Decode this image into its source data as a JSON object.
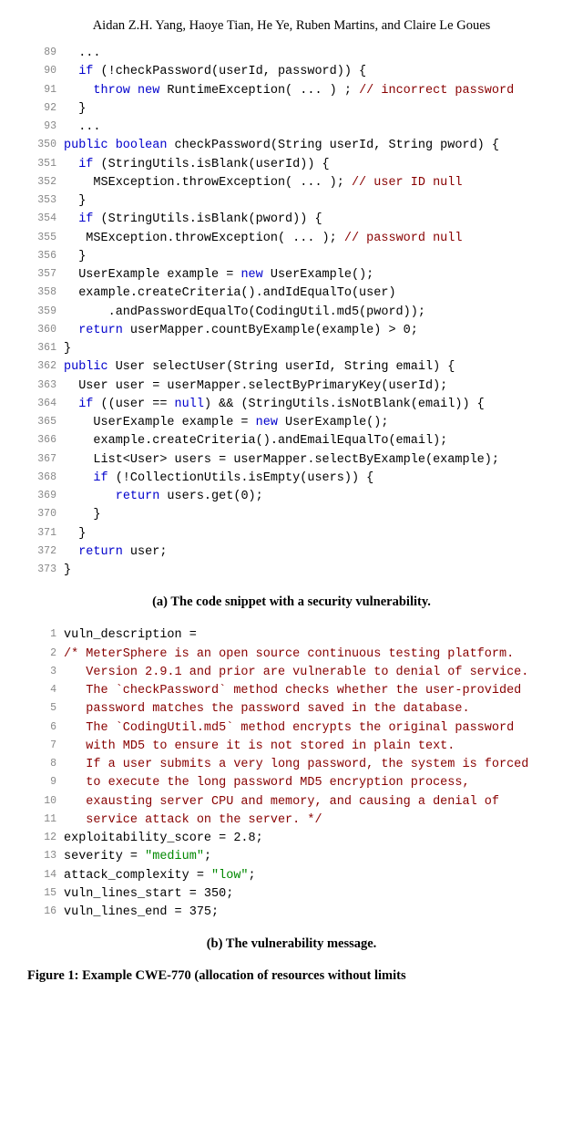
{
  "authors": "Aidan Z.H. Yang, Haoye Tian, He Ye, Ruben Martins, and Claire Le Goues",
  "listingA": [
    {
      "n": "89",
      "tokens": [
        {
          "t": "  ..."
        }
      ]
    },
    {
      "n": "90",
      "tokens": [
        {
          "t": "  "
        },
        {
          "t": "if",
          "c": "kw"
        },
        {
          "t": " (!checkPassword(userId, password)) {"
        }
      ]
    },
    {
      "n": "91",
      "tokens": [
        {
          "t": "    "
        },
        {
          "t": "throw new",
          "c": "kw"
        },
        {
          "t": " RuntimeException( ... ) ; "
        },
        {
          "t": "// incorrect password",
          "c": "com"
        }
      ]
    },
    {
      "n": "92",
      "tokens": [
        {
          "t": "  }"
        }
      ]
    },
    {
      "n": "93",
      "tokens": [
        {
          "t": "  ..."
        }
      ]
    },
    {
      "n": "350",
      "tokens": [
        {
          "t": "public boolean",
          "c": "kw"
        },
        {
          "t": " checkPassword(String userId, String pword) {"
        }
      ]
    },
    {
      "n": "351",
      "tokens": [
        {
          "t": "  "
        },
        {
          "t": "if",
          "c": "kw"
        },
        {
          "t": " (StringUtils.isBlank(userId)) {"
        }
      ]
    },
    {
      "n": "352",
      "tokens": [
        {
          "t": "    MSException.throwException( ... ); "
        },
        {
          "t": "// user ID null",
          "c": "com"
        }
      ]
    },
    {
      "n": "353",
      "tokens": [
        {
          "t": "  }"
        }
      ]
    },
    {
      "n": "354",
      "tokens": [
        {
          "t": "  "
        },
        {
          "t": "if",
          "c": "kw"
        },
        {
          "t": " (StringUtils.isBlank(pword)) {"
        }
      ]
    },
    {
      "n": "355",
      "tokens": [
        {
          "t": "   MSException.throwException( ... ); "
        },
        {
          "t": "// password null",
          "c": "com"
        }
      ]
    },
    {
      "n": "356",
      "tokens": [
        {
          "t": "  }"
        }
      ]
    },
    {
      "n": "357",
      "tokens": [
        {
          "t": "  UserExample example = "
        },
        {
          "t": "new",
          "c": "kw"
        },
        {
          "t": " UserExample();"
        }
      ]
    },
    {
      "n": "358",
      "tokens": [
        {
          "t": "  example.createCriteria().andIdEqualTo(user)"
        }
      ]
    },
    {
      "n": "359",
      "tokens": [
        {
          "t": "      .andPasswordEqualTo(CodingUtil.md5(pword));"
        }
      ]
    },
    {
      "n": "360",
      "tokens": [
        {
          "t": "  "
        },
        {
          "t": "return",
          "c": "kw"
        },
        {
          "t": " userMapper.countByExample(example) > 0;"
        }
      ]
    },
    {
      "n": "361",
      "tokens": [
        {
          "t": "}"
        }
      ]
    },
    {
      "n": "362",
      "tokens": [
        {
          "t": "public",
          "c": "kw"
        },
        {
          "t": " User selectUser(String userId, String email) {"
        }
      ]
    },
    {
      "n": "363",
      "tokens": [
        {
          "t": "  User user = userMapper.selectByPrimaryKey(userId);"
        }
      ]
    },
    {
      "n": "364",
      "tokens": [
        {
          "t": "  "
        },
        {
          "t": "if",
          "c": "kw"
        },
        {
          "t": " ((user == "
        },
        {
          "t": "null",
          "c": "kw"
        },
        {
          "t": ") && (StringUtils.isNotBlank(email)) {"
        }
      ]
    },
    {
      "n": "365",
      "tokens": [
        {
          "t": "    UserExample example = "
        },
        {
          "t": "new",
          "c": "kw"
        },
        {
          "t": " UserExample();"
        }
      ]
    },
    {
      "n": "366",
      "tokens": [
        {
          "t": "    example.createCriteria().andEmailEqualTo(email);"
        }
      ]
    },
    {
      "n": "367",
      "tokens": [
        {
          "t": "    List<User> users = userMapper.selectByExample(example);"
        }
      ]
    },
    {
      "n": "368",
      "tokens": [
        {
          "t": "    "
        },
        {
          "t": "if",
          "c": "kw"
        },
        {
          "t": " (!CollectionUtils.isEmpty(users)) {"
        }
      ]
    },
    {
      "n": "369",
      "tokens": [
        {
          "t": "       "
        },
        {
          "t": "return",
          "c": "kw"
        },
        {
          "t": " users.get(0);"
        }
      ]
    },
    {
      "n": "370",
      "tokens": [
        {
          "t": "    }"
        }
      ]
    },
    {
      "n": "371",
      "tokens": [
        {
          "t": "  }"
        }
      ]
    },
    {
      "n": "372",
      "tokens": [
        {
          "t": "  "
        },
        {
          "t": "return",
          "c": "kw"
        },
        {
          "t": " user;"
        }
      ]
    },
    {
      "n": "373",
      "tokens": [
        {
          "t": "}"
        }
      ]
    }
  ],
  "captionA": "(a) The code snippet with a security vulnerability.",
  "listingB": [
    {
      "n": "1",
      "tokens": [
        {
          "t": "vuln_description ="
        }
      ]
    },
    {
      "n": "2",
      "tokens": [
        {
          "t": "/* MeterSphere is an open source continuous testing platform.",
          "c": "com"
        }
      ]
    },
    {
      "n": "3",
      "tokens": [
        {
          "t": "   Version 2.9.1 and prior are vulnerable to denial of service.",
          "c": "com"
        }
      ]
    },
    {
      "n": "4",
      "tokens": [
        {
          "t": "   The `checkPassword` method checks whether the user-provided",
          "c": "com"
        }
      ]
    },
    {
      "n": "5",
      "tokens": [
        {
          "t": "   password matches the password saved in the database.",
          "c": "com"
        }
      ]
    },
    {
      "n": "6",
      "tokens": [
        {
          "t": "   The `CodingUtil.md5` method encrypts the original password",
          "c": "com"
        }
      ]
    },
    {
      "n": "7",
      "tokens": [
        {
          "t": "   with MD5 to ensure it is not stored in plain text.",
          "c": "com"
        }
      ]
    },
    {
      "n": "8",
      "tokens": [
        {
          "t": "   If a user submits a very long password, the system is forced",
          "c": "com"
        }
      ]
    },
    {
      "n": "9",
      "tokens": [
        {
          "t": "   to execute the long password MD5 encryption process,",
          "c": "com"
        }
      ]
    },
    {
      "n": "10",
      "tokens": [
        {
          "t": "   exausting server CPU and memory, and causing a denial of",
          "c": "com"
        }
      ]
    },
    {
      "n": "11",
      "tokens": [
        {
          "t": "   service attack on the server. */",
          "c": "com"
        }
      ]
    },
    {
      "n": "12",
      "tokens": [
        {
          "t": "exploitability_score = 2.8;"
        }
      ]
    },
    {
      "n": "13",
      "tokens": [
        {
          "t": "severity = "
        },
        {
          "t": "\"medium\"",
          "c": "str"
        },
        {
          "t": ";"
        }
      ]
    },
    {
      "n": "14",
      "tokens": [
        {
          "t": "attack_complexity = "
        },
        {
          "t": "\"low\"",
          "c": "str"
        },
        {
          "t": ";"
        }
      ]
    },
    {
      "n": "15",
      "tokens": [
        {
          "t": "vuln_lines_start = 350;"
        }
      ]
    },
    {
      "n": "16",
      "tokens": [
        {
          "t": "vuln_lines_end = 375;"
        }
      ]
    }
  ],
  "captionB": "(b) The vulnerability message.",
  "figureLabel": "Figure 1: Example CWE-770 (allocation of resources without limits"
}
